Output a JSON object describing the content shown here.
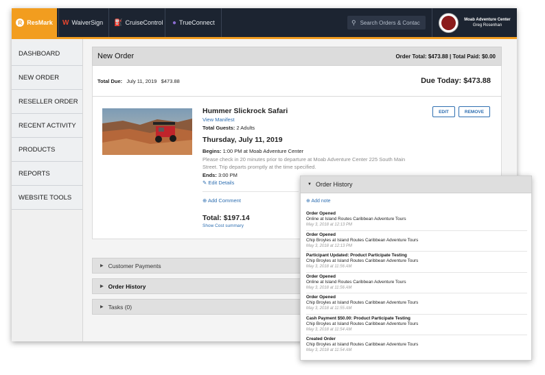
{
  "topbar": {
    "brand": "ResMark",
    "products": [
      {
        "label": "WaiverSign",
        "icon": "waiversign-logo-icon"
      },
      {
        "label": "CruiseControl",
        "icon": "cruisecontrol-logo-icon"
      },
      {
        "label": "TrueConnect",
        "icon": "trueconnect-logo-icon"
      }
    ],
    "search_placeholder": "Search Orders & Contac",
    "company": "Moab Adventure Center",
    "user": "Greg Rosenhan",
    "accent": "#f29d1f",
    "bar_color": "#1c2431"
  },
  "sidebar": {
    "items": [
      "DASHBOARD",
      "NEW ORDER",
      "RESELLER ORDER",
      "RECENT ACTIVITY",
      "PRODUCTS",
      "REPORTS",
      "WEBSITE TOOLS"
    ]
  },
  "order": {
    "title": "New Order",
    "totals": "Order Total: $473.88 | Total Paid: $0.00",
    "total_due_label": "Total Due:",
    "total_due_date": "July 11, 2019",
    "total_due_amount": "$473.88",
    "due_today": "Due Today: $473.88"
  },
  "item": {
    "name": "Hummer Slickrock Safari",
    "view_manifest": "View Manifest",
    "guests_label": "Total Guests:",
    "guests_value": "2 Adults",
    "date": "Thursday, July 11, 2019",
    "begins_label": "Begins:",
    "begins_value": "1:00 PM at Moab Adventure Center",
    "instructions_1": "Please check in 20 minutes prior to departure at Moab Adventure Center 225 South Main",
    "instructions_2": "Street. Trip departs promptly at the time specified.",
    "ends_label": "Ends:",
    "ends_value": "3:00 PM",
    "edit_details": "Edit Details",
    "add_comment": "Add Comment",
    "total": "Total: $197.14",
    "show_cost": "Show Cost summary",
    "edit_button": "EDIT",
    "remove_button": "REMOVE"
  },
  "sections": {
    "customer_payments": "Customer Payments",
    "order_history": "Order History",
    "tasks": "Tasks (0)"
  },
  "history_panel": {
    "title": "Order History",
    "add_note": "Add note",
    "entries": [
      {
        "title": "Order Opened",
        "detail": "Online at Island Routes Caribbean Adventure Tours",
        "time": "May 3, 2018 at 12:13 PM"
      },
      {
        "title": "Order Opened",
        "detail": "Chip Broyles at Island Routes Caribbean Adventure Tours",
        "time": "May 3, 2018 at 12:13 PM"
      },
      {
        "title": "Participant Updated: Product Participate Testing",
        "detail": "Chip Broyles at Island Routes Caribbean Adventure Tours",
        "time": "May 3, 2018 at 11:56 AM"
      },
      {
        "title": "Order Opened",
        "detail": "Online at Island Routes Caribbean Adventure Tours",
        "time": "May 3, 2018 at 11:56 AM"
      },
      {
        "title": "Order Opened",
        "detail": "Chip Broyles at Island Routes Caribbean Adventure Tours",
        "time": "May 3, 2018 at 11:55 AM"
      },
      {
        "title": "Cash Payment $50.00: Product Participate Testing",
        "detail": "Chip Broyles at Island Routes Caribbean Adventure Tours",
        "time": "May 3, 2018 at 11:54 AM"
      },
      {
        "title": "Created Order",
        "detail": "Chip Broyles at Island Routes Caribbean Adventure Tours",
        "time": "May 3, 2018 at 11:54 AM"
      }
    ]
  }
}
